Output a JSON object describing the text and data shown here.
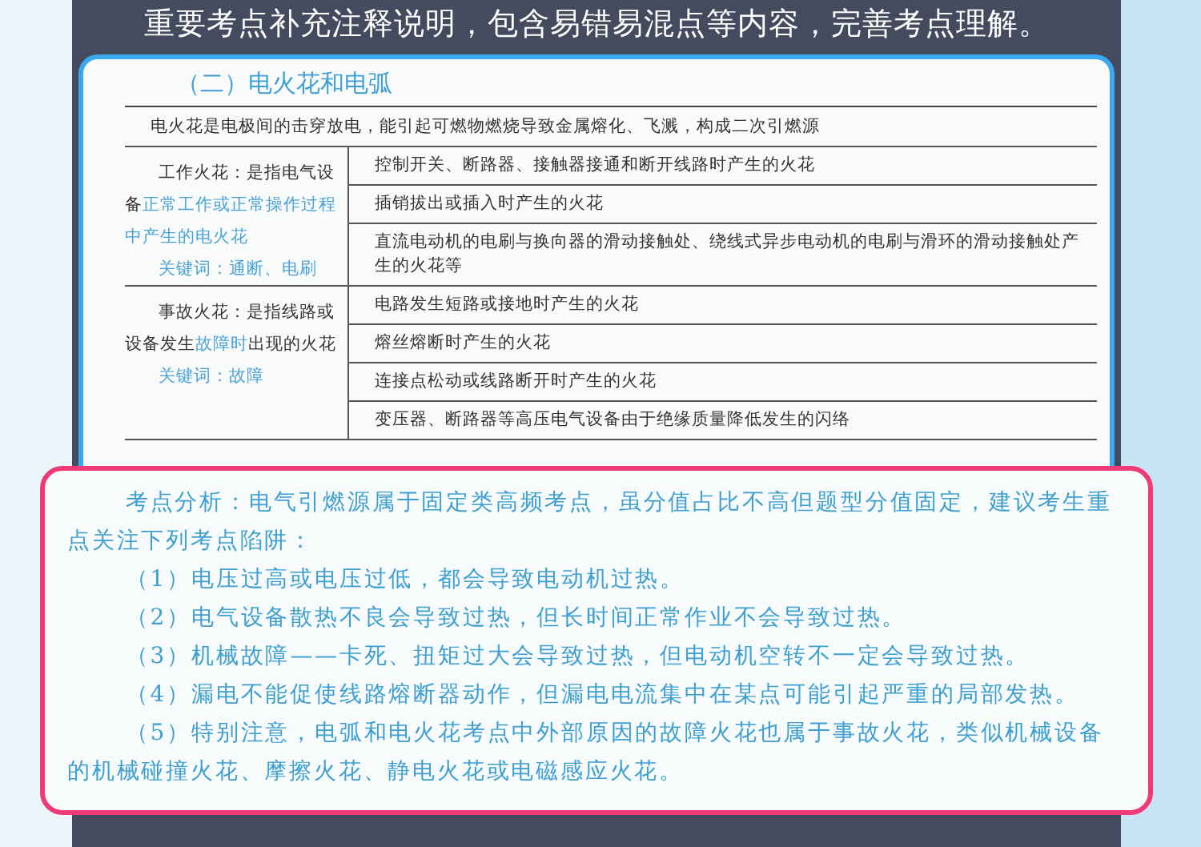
{
  "header": {
    "text": "重要考点补充注释说明，包含易错易混点等内容，完善考点理解。"
  },
  "book_page": {
    "section_title": "（二）电火花和电弧",
    "intro": "电火花是电极间的击穿放电，能引起可燃物燃烧导致金属熔化、飞溅，构成二次引燃源",
    "groups": [
      {
        "label_parts": [
          {
            "text": "工作火花：是指电气设备",
            "highlight": false
          },
          {
            "text": "正常工作或正常操作过程中产生的电火花",
            "highlight": true
          }
        ],
        "keyword": "关键词：通断、电刷",
        "rows": [
          "控制开关、断路器、接触器接通和断开线路时产生的火花",
          "插销拔出或插入时产生的火花",
          "直流电动机的电刷与换向器的滑动接触处、绕线式异步电动机的电刷与滑环的滑动接触处产生的火花等"
        ]
      },
      {
        "label_parts": [
          {
            "text": "事故火花：是指线路或设备发生",
            "highlight": false
          },
          {
            "text": "故障时",
            "highlight": true
          },
          {
            "text": "出现的火花",
            "highlight": false
          }
        ],
        "keyword": "关键词：故障",
        "rows": [
          "电路发生短路或接地时产生的火花",
          "熔丝熔断时产生的火花",
          "连接点松动或线路断开时产生的火花",
          "变压器、断路器等高压电气设备由于绝缘质量降低发生的闪络"
        ]
      }
    ]
  },
  "analysis": {
    "intro": "考点分析：电气引燃源属于固定类高频考点，虽分值占比不高但题型分值固定，建议考生重点关注下列考点陷阱：",
    "items": [
      "（1）电压过高或电压过低，都会导致电动机过热。",
      "（2）电气设备散热不良会导致过热，但长时间正常作业不会导致过热。",
      "（3）机械故障——卡死、扭矩过大会导致过热，但电动机空转不一定会导致过热。",
      "（4）漏电不能促使线路熔断器动作，但漏电电流集中在某点可能引起严重的局部发热。",
      "（5）特别注意，电弧和电火花考点中外部原因的故障火花也属于事故火花，类似机械设备的机械碰撞火花、摩擦火花、静电火花或电磁感应火花。"
    ]
  }
}
